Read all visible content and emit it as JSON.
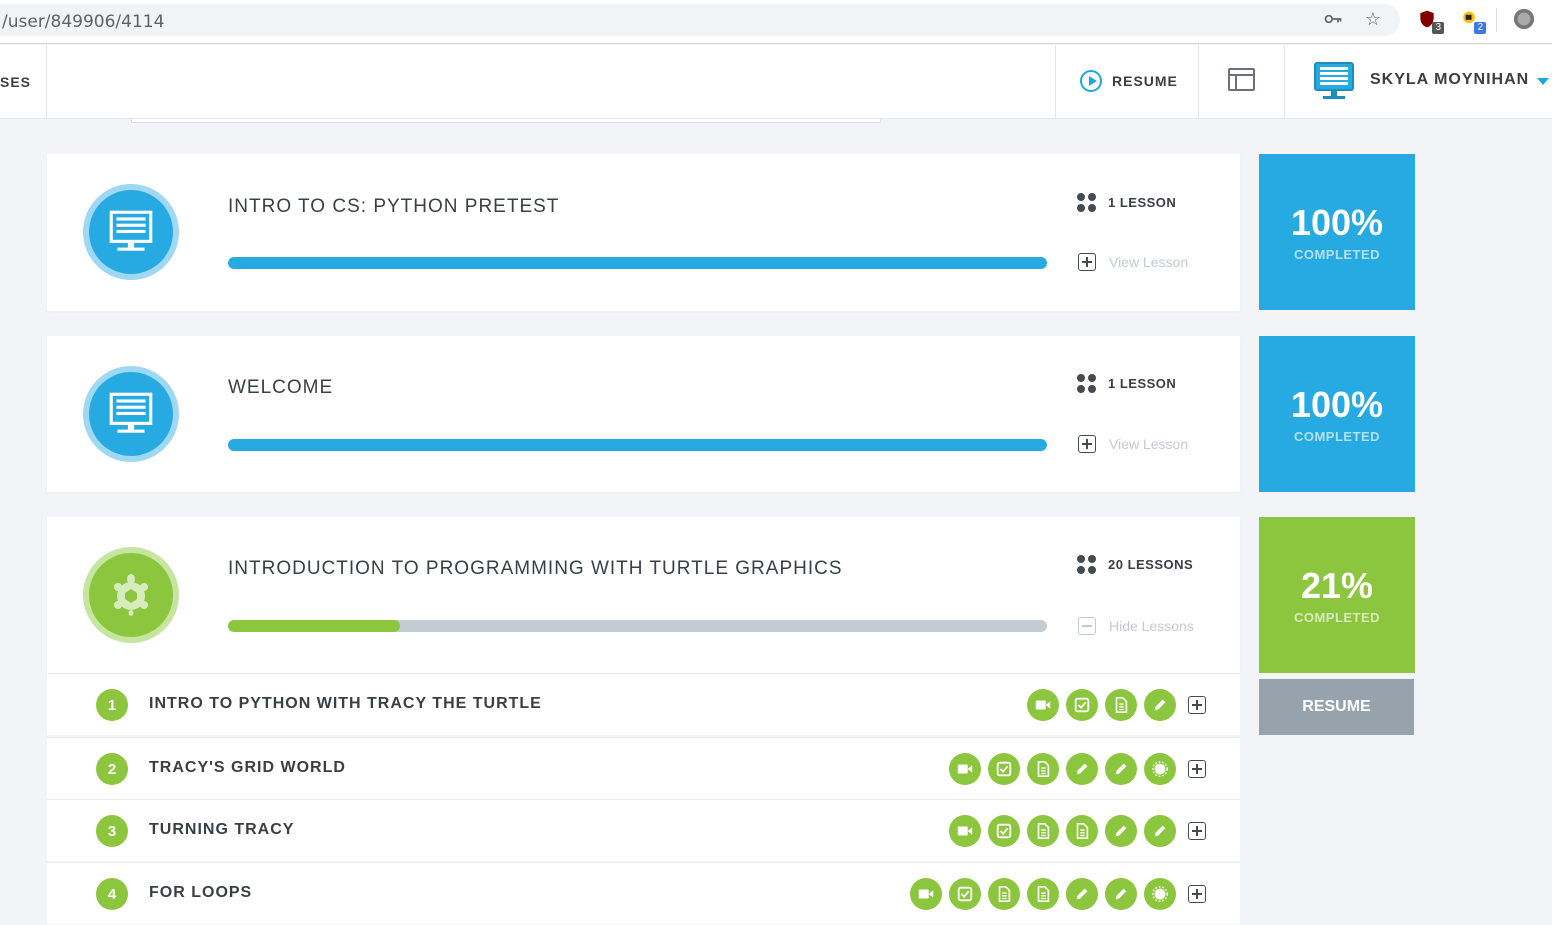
{
  "browser": {
    "url": "/user/849906/4114",
    "extension_badges": [
      "3",
      "2"
    ]
  },
  "header": {
    "nav_cut_label": "SES",
    "resume_label": "RESUME",
    "user_name": "SKYLA MOYNIHAN"
  },
  "courses": [
    {
      "title": "INTRO TO CS: PYTHON PRETEST",
      "lesson_count": "1 LESSON",
      "toggle_label": "View Lesson",
      "progress_percent": 100,
      "completion_percent": "100%",
      "completion_label": "COMPLETED",
      "icon": "monitor-icon",
      "color": "#27a9e1"
    },
    {
      "title": "WELCOME",
      "lesson_count": "1 LESSON",
      "toggle_label": "View Lesson",
      "progress_percent": 100,
      "completion_percent": "100%",
      "completion_label": "COMPLETED",
      "icon": "monitor-icon",
      "color": "#27a9e1"
    },
    {
      "title": "INTRODUCTION TO PROGRAMMING WITH TURTLE GRAPHICS",
      "lesson_count": "20 LESSONS",
      "toggle_label": "Hide Lessons",
      "progress_percent": 21,
      "completion_percent": "21%",
      "completion_label": "COMPLETED",
      "resume_label": "RESUME",
      "icon": "turtle-icon",
      "color": "#8cc63e"
    }
  ],
  "lessons": [
    {
      "number": "1",
      "name": "INTRO TO PYTHON WITH TRACY THE TURTLE",
      "activities": [
        "video-icon",
        "quiz-check-icon",
        "document-icon",
        "pencil-icon"
      ]
    },
    {
      "number": "2",
      "name": "TRACY'S GRID WORLD",
      "activities": [
        "video-icon",
        "quiz-check-icon",
        "document-icon",
        "pencil-icon",
        "pencil-icon",
        "badge-icon"
      ]
    },
    {
      "number": "3",
      "name": "TURNING TRACY",
      "activities": [
        "video-icon",
        "quiz-check-icon",
        "document-icon",
        "document-icon",
        "pencil-icon",
        "pencil-icon"
      ]
    },
    {
      "number": "4",
      "name": "FOR LOOPS",
      "activities": [
        "video-icon",
        "quiz-check-icon",
        "document-icon",
        "document-icon",
        "pencil-icon",
        "pencil-icon",
        "badge-icon"
      ]
    }
  ],
  "colors": {
    "blue": "#27a9e1",
    "green": "#8cc63e",
    "gray_button": "#97a3ac",
    "progress_track": "#c4ccd3"
  }
}
